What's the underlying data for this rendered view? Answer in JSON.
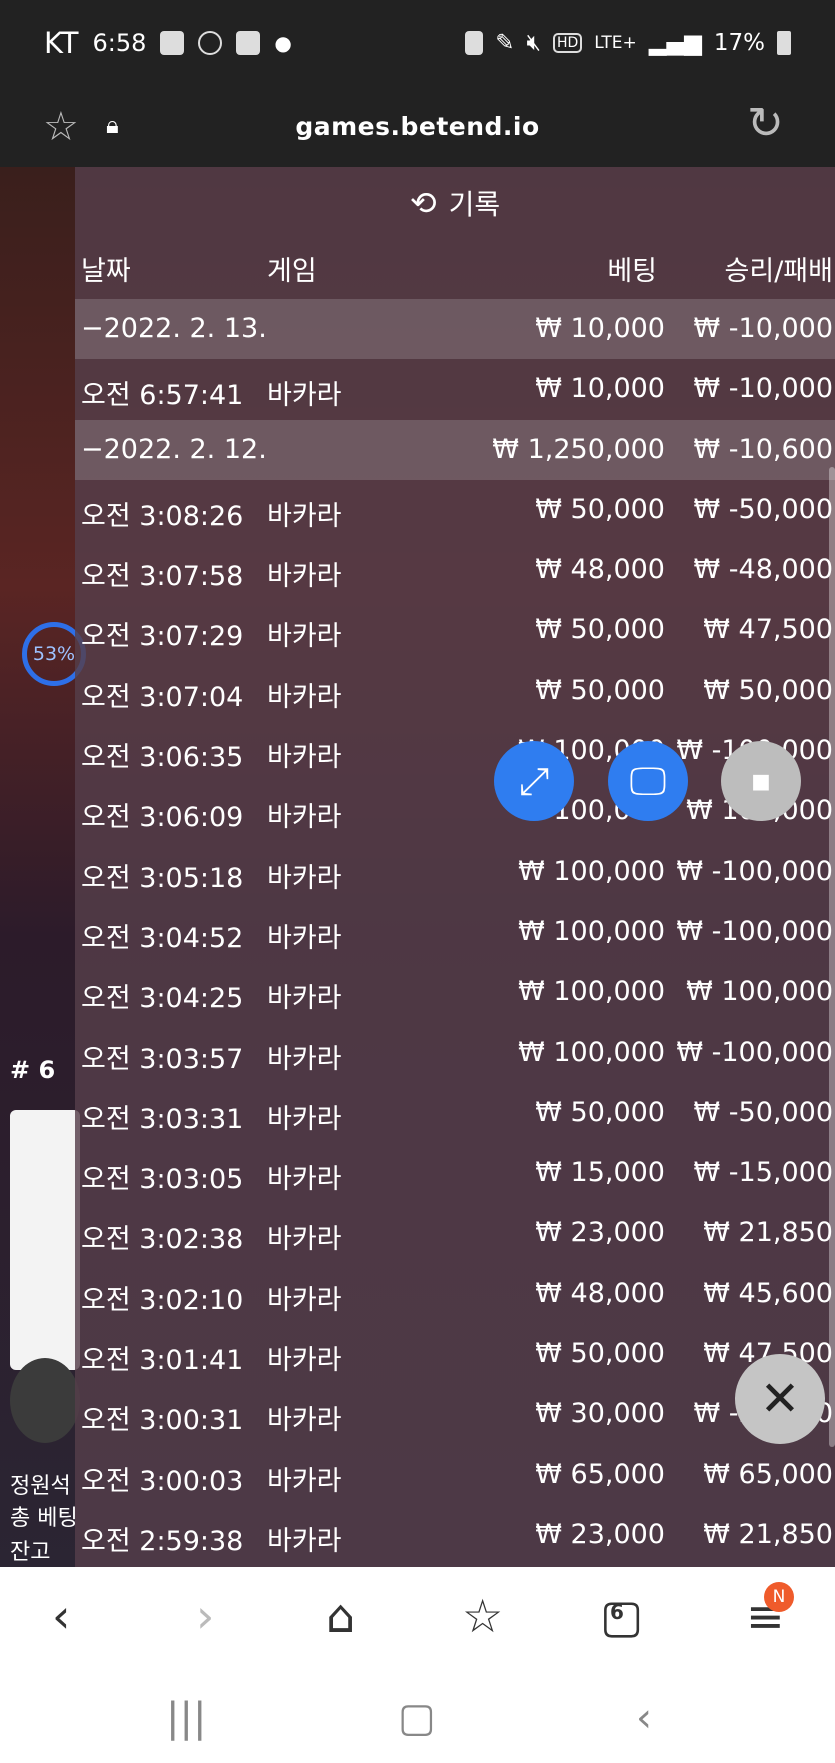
{
  "status_bar": {
    "carrier": "KT",
    "time": "6:58",
    "network": "LTE+",
    "hd": "HD",
    "battery": "17%"
  },
  "url_bar": {
    "url": "games.betend.io"
  },
  "panel": {
    "title": "기록",
    "columns": {
      "date": "날짜",
      "game": "게임",
      "bet": "베팅",
      "win_loss": "승리/패배"
    },
    "rows": [
      {
        "group": true,
        "date": "−2022. 2. 13.",
        "game": "",
        "bet": "₩ 10,000",
        "win": "₩ -10,000"
      },
      {
        "group": false,
        "date": "오전 6:57:41",
        "game": "바카라",
        "bet": "₩ 10,000",
        "win": "₩ -10,000"
      },
      {
        "group": true,
        "date": "−2022. 2. 12.",
        "game": "",
        "bet": "₩ 1,250,000",
        "win": "₩ -10,600"
      },
      {
        "group": false,
        "date": "오전 3:08:26",
        "game": "바카라",
        "bet": "₩ 50,000",
        "win": "₩ -50,000"
      },
      {
        "group": false,
        "date": "오전 3:07:58",
        "game": "바카라",
        "bet": "₩ 48,000",
        "win": "₩ -48,000"
      },
      {
        "group": false,
        "date": "오전 3:07:29",
        "game": "바카라",
        "bet": "₩ 50,000",
        "win": "₩ 47,500"
      },
      {
        "group": false,
        "date": "오전 3:07:04",
        "game": "바카라",
        "bet": "₩ 50,000",
        "win": "₩ 50,000"
      },
      {
        "group": false,
        "date": "오전 3:06:35",
        "game": "바카라",
        "bet": "₩ 100,000",
        "win": "₩ -100,000"
      },
      {
        "group": false,
        "date": "오전 3:06:09",
        "game": "바카라",
        "bet": "₩ 100,000",
        "win": "₩ 100,000"
      },
      {
        "group": false,
        "date": "오전 3:05:18",
        "game": "바카라",
        "bet": "₩ 100,000",
        "win": "₩ -100,000"
      },
      {
        "group": false,
        "date": "오전 3:04:52",
        "game": "바카라",
        "bet": "₩ 100,000",
        "win": "₩ -100,000"
      },
      {
        "group": false,
        "date": "오전 3:04:25",
        "game": "바카라",
        "bet": "₩ 100,000",
        "win": "₩ 100,000"
      },
      {
        "group": false,
        "date": "오전 3:03:57",
        "game": "바카라",
        "bet": "₩ 100,000",
        "win": "₩ -100,000"
      },
      {
        "group": false,
        "date": "오전 3:03:31",
        "game": "바카라",
        "bet": "₩ 50,000",
        "win": "₩ -50,000"
      },
      {
        "group": false,
        "date": "오전 3:03:05",
        "game": "바카라",
        "bet": "₩ 15,000",
        "win": "₩ -15,000"
      },
      {
        "group": false,
        "date": "오전 3:02:38",
        "game": "바카라",
        "bet": "₩ 23,000",
        "win": "₩ 21,850"
      },
      {
        "group": false,
        "date": "오전 3:02:10",
        "game": "바카라",
        "bet": "₩ 48,000",
        "win": "₩ 45,600"
      },
      {
        "group": false,
        "date": "오전 3:01:41",
        "game": "바카라",
        "bet": "₩ 50,000",
        "win": "₩ 47,500"
      },
      {
        "group": false,
        "date": "오전 3:00:31",
        "game": "바카라",
        "bet": "₩ 30,000",
        "win": "₩ -30,000"
      },
      {
        "group": false,
        "date": "오전 3:00:03",
        "game": "바카라",
        "bet": "₩ 65,000",
        "win": "₩ 65,000"
      },
      {
        "group": false,
        "date": "오전 2:59:38",
        "game": "바카라",
        "bet": "₩ 23,000",
        "win": "₩ 21,850"
      }
    ]
  },
  "left_overlay": {
    "percent": "53%",
    "label_hash": "# 6",
    "seat_text": "정원석",
    "total_bet_text": "총 베팅",
    "balance_text": "잔고"
  },
  "bottom_nav": {
    "tabs_count": "6",
    "badge": "N"
  },
  "icons": {
    "history": "history-icon",
    "expand": "expand-icon",
    "monitor": "monitor-icon",
    "stop": "stop-icon",
    "close": "close-icon"
  }
}
